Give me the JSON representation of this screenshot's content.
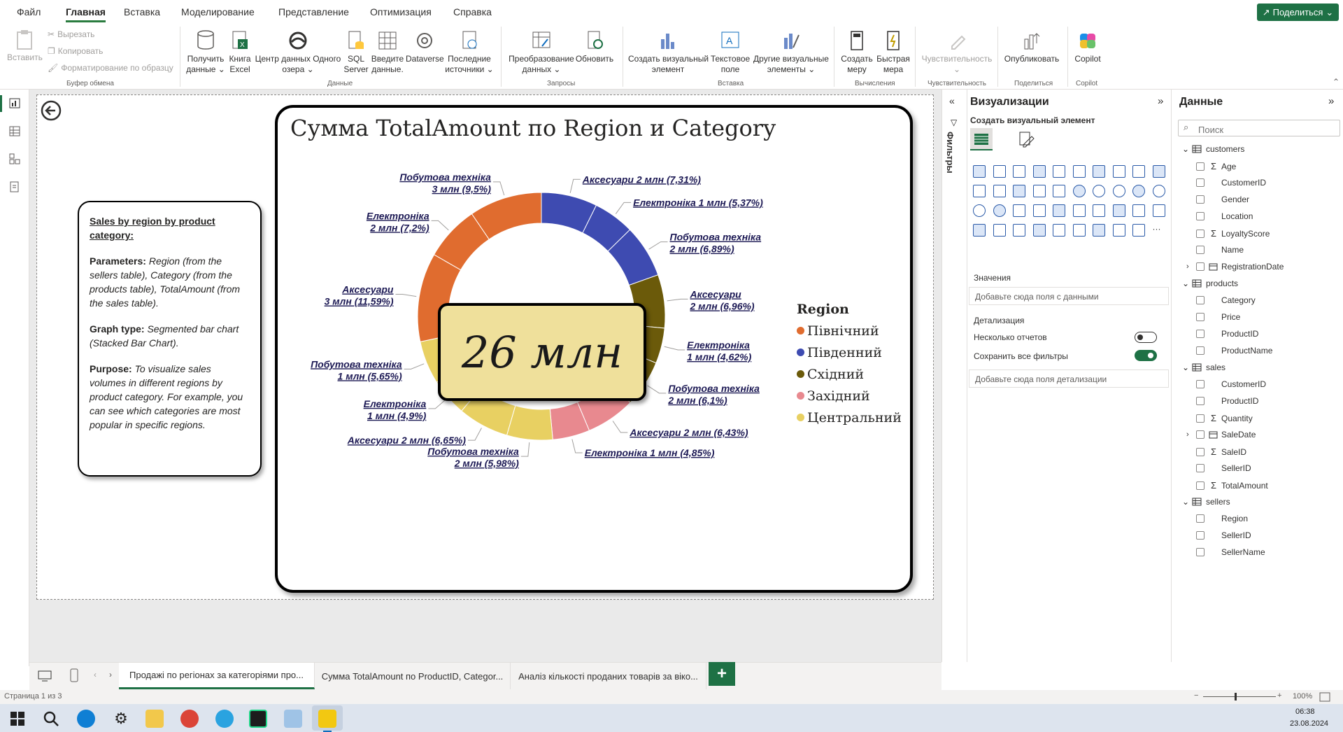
{
  "menu": {
    "items": [
      "Файл",
      "Главная",
      "Вставка",
      "Моделирование",
      "Представление",
      "Оптимизация",
      "Справка"
    ],
    "active_index": 1,
    "share_label": "Поделиться"
  },
  "ribbon": {
    "clipboard": {
      "paste": "Вставить",
      "cut": "Вырезать",
      "copy": "Копировать",
      "format_painter": "Форматирование по образцу",
      "group": "Буфер обмена"
    },
    "data": {
      "get_data_1": "Получить",
      "get_data_2": "данные",
      "excel_1": "Книга",
      "excel_2": "Excel",
      "onelake_1": "Центр данных Одного",
      "onelake_2": "озера",
      "sql_1": "SQL",
      "sql_2": "Server",
      "enter_1": "Введите",
      "enter_2": "данные.",
      "dataverse": "Dataverse",
      "recent_1": "Последние",
      "recent_2": "источники",
      "group": "Данные"
    },
    "queries": {
      "transform_1": "Преобразование",
      "transform_2": "данных",
      "refresh": "Обновить",
      "group": "Запросы"
    },
    "insert": {
      "new_visual_1": "Создать визуальный",
      "new_visual_2": "элемент",
      "textbox_1": "Текстовое",
      "textbox_2": "поле",
      "more_visuals_1": "Другие визуальные",
      "more_visuals_2": "элементы",
      "group": "Вставка"
    },
    "calc": {
      "new_measure_1": "Создать",
      "new_measure_2": "меру",
      "quick_measure_1": "Быстрая",
      "quick_measure_2": "мера",
      "group": "Вычисления"
    },
    "sensitivity": {
      "label": "Чувствительность",
      "group": "Чувствительность"
    },
    "share": {
      "publish": "Опубликовать",
      "group": "Поделиться"
    },
    "copilot": {
      "label": "Copilot",
      "group": "Copilot"
    }
  },
  "text_card": {
    "heading": "Sales by region by product category:",
    "params_label": "Parameters:",
    "params_text": "Region (from the sellers table), Category (from the products table), TotalAmount (from the sales table).",
    "graph_label": "Graph type:",
    "graph_text": "Segmented bar chart (Stacked Bar Chart).",
    "purpose_label": "Purpose:",
    "purpose_text": "To visualize sales volumes in different regions by product category. For example, you can see which categories are most popular in specific regions."
  },
  "chart_data": {
    "type": "pie",
    "donut": true,
    "title": "Сумма TotalAmount по Region и Category",
    "center_label": "26 млн",
    "legend_title": "Region",
    "legend_position": "right",
    "regions": [
      {
        "name": "Північний",
        "color": "#e06c2f"
      },
      {
        "name": "Південний",
        "color": "#3e4bb1"
      },
      {
        "name": "Східний",
        "color": "#6b5a0a"
      },
      {
        "name": "Західний",
        "color": "#e8898f"
      },
      {
        "name": "Центральний",
        "color": "#e8d062"
      }
    ],
    "slices": [
      {
        "region": "Південний",
        "category": "Аксесуари",
        "value_text": "2 млн",
        "percent": 7.31,
        "label": "Аксесуари 2 млн (7,31%)"
      },
      {
        "region": "Південний",
        "category": "Електроніка",
        "value_text": "1 млн",
        "percent": 5.37,
        "label": "Електроніка 1 млн (5,37%)"
      },
      {
        "region": "Південний",
        "category": "Побутова техніка",
        "value_text": "2 млн",
        "percent": 6.89,
        "label": "Побутова техніка 2 млн (6,89%)"
      },
      {
        "region": "Східний",
        "category": "Аксесуари",
        "value_text": "2 млн",
        "percent": 6.96,
        "label": "Аксесуари 2 млн (6,96%)"
      },
      {
        "region": "Східний",
        "category": "Електроніка",
        "value_text": "1 млн",
        "percent": 4.62,
        "label": "Електроніка 1 млн (4,62%)"
      },
      {
        "region": "Східний",
        "category": "Побутова техніка",
        "value_text": "2 млн",
        "percent": 6.1,
        "label": "Побутова техніка 2 млн (6,1%)"
      },
      {
        "region": "Західний",
        "category": "Аксесуари",
        "value_text": "2 млн",
        "percent": 6.43,
        "label": "Аксесуари 2 млн (6,43%)"
      },
      {
        "region": "Західний",
        "category": "Електроніка",
        "value_text": "1 млн",
        "percent": 4.85,
        "label": "Електроніка 1 млн (4,85%)"
      },
      {
        "region": "Центральний",
        "category": "Побутова техніка",
        "value_text": "2 млн",
        "percent": 5.98,
        "label": "Побутова техніка 2 млн (5,98%)"
      },
      {
        "region": "Центральний",
        "category": "Аксесуари",
        "value_text": "2 млн",
        "percent": 6.65,
        "label": "Аксесуари 2 млн (6,65%)"
      },
      {
        "region": "Центральний",
        "category": "Електроніка",
        "value_text": "1 млн",
        "percent": 4.9,
        "label": "Електроніка 1 млн (4,9%)"
      },
      {
        "region": "Центральний",
        "category": "Побутова техніка",
        "value_text": "1 млн",
        "percent": 5.65,
        "label": "Побутова техніка 1 млн (5,65%)"
      },
      {
        "region": "Північний",
        "category": "Аксесуари",
        "value_text": "3 млн",
        "percent": 11.59,
        "label": "Аксесуари 3 млн (11,59%)"
      },
      {
        "region": "Північний",
        "category": "Електроніка",
        "value_text": "2 млн",
        "percent": 7.2,
        "label": "Електроніка 2 млн (7,2%)"
      },
      {
        "region": "Північний",
        "category": "Побутова техніка",
        "value_text": "3 млн",
        "percent": 9.5,
        "label": "Побутова техніка 3 млн (9,5%)"
      }
    ]
  },
  "page_tabs": [
    "Продажі по регіонах за категоріями про...",
    "Сумма TotalAmount по ProductID, Categor...",
    "Аналіз кількості проданих товарів за віко..."
  ],
  "status": {
    "page": "Страница 1 из 3",
    "zoom": "100%"
  },
  "filters_label": "Фильтры",
  "viz_pane": {
    "title": "Визуализации",
    "build_label": "Создать визуальный элемент",
    "values_label": "Значения",
    "values_placeholder": "Добавьте сюда поля с данными",
    "drill_label": "Детализация",
    "multi_reports": "Несколько отчетов",
    "multi_reports_on": false,
    "keep_filters": "Сохранить все фильтры",
    "keep_filters_on": true,
    "drill_placeholder": "Добавьте сюда поля детализации"
  },
  "data_pane": {
    "title": "Данные",
    "search_placeholder": "Поиск",
    "tables": [
      {
        "name": "customers",
        "fields": [
          {
            "name": "Age",
            "sigma": true
          },
          {
            "name": "CustomerID",
            "sigma": false
          },
          {
            "name": "Gender",
            "sigma": false
          },
          {
            "name": "Location",
            "sigma": false
          },
          {
            "name": "LoyaltyScore",
            "sigma": true
          },
          {
            "name": "Name",
            "sigma": false
          },
          {
            "name": "RegistrationDate",
            "sigma": false,
            "hierarchy": true
          }
        ]
      },
      {
        "name": "products",
        "fields": [
          {
            "name": "Category",
            "sigma": false
          },
          {
            "name": "Price",
            "sigma": false
          },
          {
            "name": "ProductID",
            "sigma": false
          },
          {
            "name": "ProductName",
            "sigma": false
          }
        ]
      },
      {
        "name": "sales",
        "fields": [
          {
            "name": "CustomerID",
            "sigma": false
          },
          {
            "name": "ProductID",
            "sigma": false
          },
          {
            "name": "Quantity",
            "sigma": true
          },
          {
            "name": "SaleDate",
            "sigma": false,
            "hierarchy": true
          },
          {
            "name": "SaleID",
            "sigma": true
          },
          {
            "name": "SellerID",
            "sigma": false
          },
          {
            "name": "TotalAmount",
            "sigma": true
          }
        ]
      },
      {
        "name": "sellers",
        "fields": [
          {
            "name": "Region",
            "sigma": false
          },
          {
            "name": "SellerID",
            "sigma": false
          },
          {
            "name": "SellerName",
            "sigma": false
          }
        ]
      }
    ]
  },
  "taskbar": {
    "time": "06:38",
    "date": "23.08.2024"
  },
  "colors": {
    "brand_green": "#1e7145"
  }
}
